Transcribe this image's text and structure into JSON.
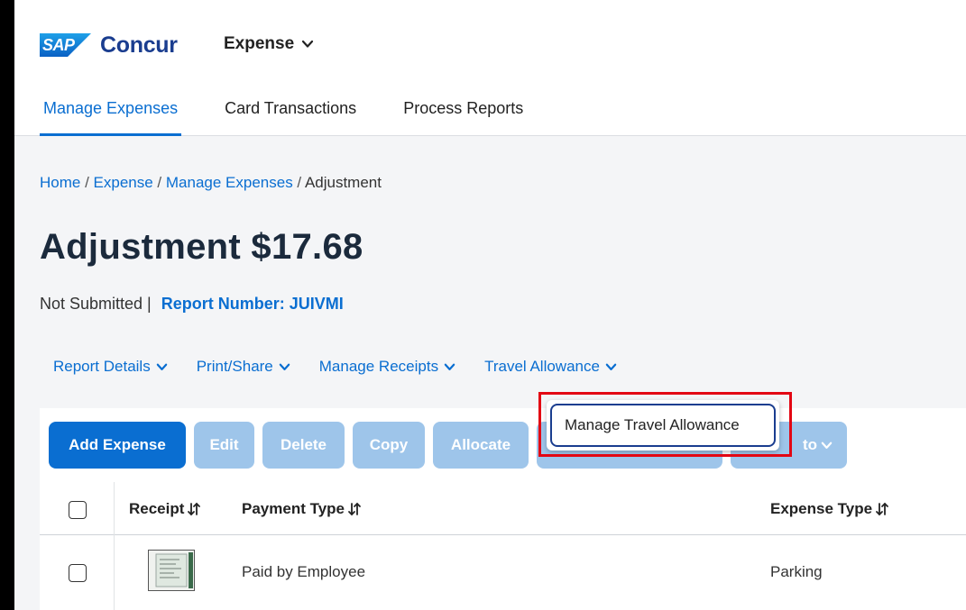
{
  "header": {
    "logo_sap": "SAP",
    "logo_concur": "Concur",
    "product": "Expense",
    "tabs": [
      {
        "label": "Manage Expenses"
      },
      {
        "label": "Card Transactions"
      },
      {
        "label": "Process Reports"
      }
    ]
  },
  "breadcrumb": {
    "home": "Home",
    "expense": "Expense",
    "manage_expenses": "Manage Expenses",
    "current": "Adjustment",
    "separator": " / "
  },
  "report": {
    "title": "Adjustment $17.68",
    "status": "Not Submitted |",
    "report_number": "Report Number: JUIVMI"
  },
  "report_menu": [
    {
      "label": "Report Details"
    },
    {
      "label": "Print/Share"
    },
    {
      "label": "Manage Receipts"
    },
    {
      "label": "Travel Allowance"
    }
  ],
  "toolbar": {
    "add_expense": "Add Expense",
    "edit": "Edit",
    "delete": "Delete",
    "copy": "Copy",
    "allocate": "Allocate",
    "move_to_partial": "to"
  },
  "dropdown": {
    "item": "Manage Travel Allowance"
  },
  "table": {
    "columns": [
      {
        "label": "Receipt"
      },
      {
        "label": "Payment Type"
      },
      {
        "label": "Expense Type"
      }
    ],
    "rows": [
      {
        "payment_type": "Paid by Employee",
        "expense_type": "Parking"
      }
    ]
  },
  "colors": {
    "accent": "#0a6ed1",
    "brand_dark": "#1a3d8f",
    "highlight": "#e30613",
    "disabled_button": "#9ec5ea"
  }
}
